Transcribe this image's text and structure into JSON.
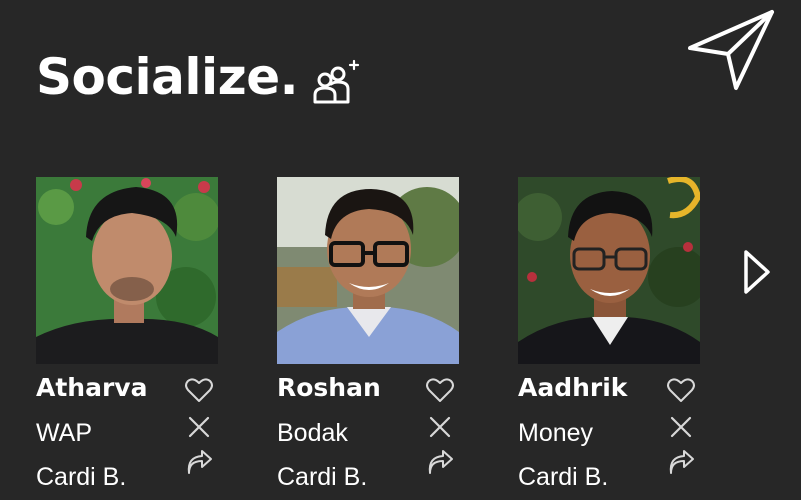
{
  "header": {
    "title": "Socialize.",
    "add_friend_icon": "add-friend-icon",
    "send_icon": "paper-plane-icon"
  },
  "navigation": {
    "next_icon": "triangle-right-icon"
  },
  "cards": [
    {
      "name": "Atharva",
      "line2": "WAP",
      "line3": "Cardi B."
    },
    {
      "name": "Roshan",
      "line2": "Bodak",
      "line3": "Cardi B."
    },
    {
      "name": "Aadhrik",
      "line2": "Money",
      "line3": "Cardi B."
    }
  ],
  "colors": {
    "background": "#272727",
    "text": "#ffffff",
    "icon": "#d8d8d8"
  }
}
